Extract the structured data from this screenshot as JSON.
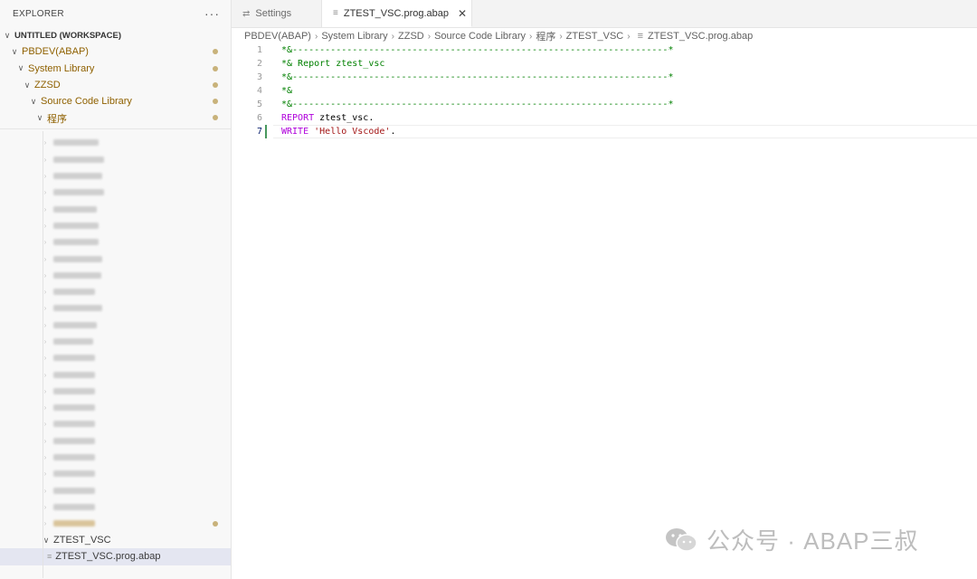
{
  "sidebar": {
    "title": "EXPLORER",
    "more": "···",
    "workspace": "UNTITLED (WORKSPACE)",
    "nodes": [
      "PBDEV(ABAP)",
      "System Library",
      "ZZSD",
      "Source Code Library",
      "程序"
    ],
    "ztest_folder": "ZTEST_VSC",
    "selected_file": "ZTEST_VSC.prog.abap"
  },
  "tabs": [
    {
      "label": "Settings",
      "icon": "settings-icon"
    },
    {
      "label": "ZTEST_VSC.prog.abap",
      "icon": "file-icon",
      "close": "✕"
    }
  ],
  "breadcrumb": [
    "PBDEV(ABAP)",
    "System Library",
    "ZZSD",
    "Source Code Library",
    "程序",
    "ZTEST_VSC",
    "ZTEST_VSC.prog.abap"
  ],
  "editor": {
    "current_line": 7,
    "lines": [
      {
        "n": "1",
        "parts": [
          {
            "t": "*&---------------------------------------------------------------------*",
            "c": "cm"
          }
        ]
      },
      {
        "n": "2",
        "parts": [
          {
            "t": "*& Report ztest_vsc",
            "c": "cm"
          }
        ]
      },
      {
        "n": "3",
        "parts": [
          {
            "t": "*&---------------------------------------------------------------------*",
            "c": "cm"
          }
        ]
      },
      {
        "n": "4",
        "parts": [
          {
            "t": "*&",
            "c": "cm"
          }
        ]
      },
      {
        "n": "5",
        "parts": [
          {
            "t": "*&---------------------------------------------------------------------*",
            "c": "cm"
          }
        ]
      },
      {
        "n": "6",
        "parts": [
          {
            "t": "REPORT",
            "c": "kw"
          },
          {
            "t": " ztest_vsc.",
            "c": "tx"
          }
        ]
      },
      {
        "n": "7",
        "parts": [
          {
            "t": "WRITE",
            "c": "kw"
          },
          {
            "t": " ",
            "c": "tx"
          },
          {
            "t": "'Hello Vscode'",
            "c": "str"
          },
          {
            "t": ".",
            "c": "tx"
          }
        ]
      }
    ]
  },
  "watermark": "公众号 · ABAP三叔",
  "colors": {
    "modified": "#8f6100",
    "comment": "#008000",
    "keyword": "#af00db",
    "string": "#a31515",
    "git_added": "#48985d"
  }
}
